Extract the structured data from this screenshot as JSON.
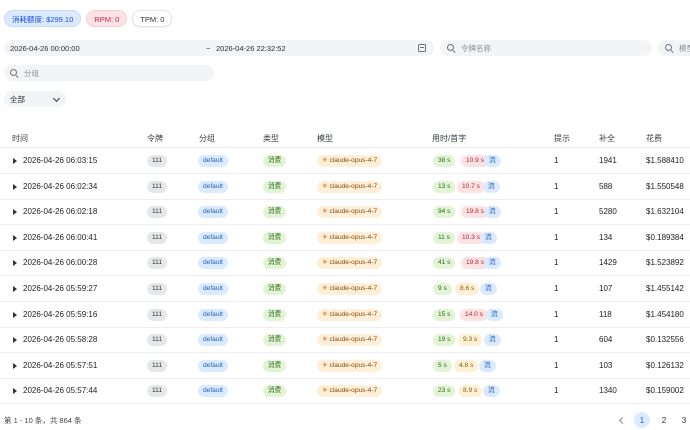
{
  "stats": {
    "quota": "消耗额度: $299.10",
    "rpm": "RPM: 0",
    "tpm": "TPM: 0"
  },
  "filters": {
    "start": "2026-04-26 00:00:00",
    "sep": "~",
    "end": "2026-04-26 22:32:52",
    "token_placeholder": "令牌名称",
    "model_placeholder": "模型",
    "group_placeholder": "分组",
    "type_select": "全部"
  },
  "columns": [
    "时间",
    "令牌",
    "分组",
    "类型",
    "模型",
    "用时/首字",
    "提示",
    "补全",
    "花费"
  ],
  "rows": [
    {
      "time": "2026-04-26 06:03:15",
      "token": "111",
      "group": "default",
      "type": "消费",
      "model": "claude-opus-4-7",
      "dur": "38 s",
      "ttft": "10.9 s",
      "stream": "流",
      "prompt": "1",
      "completion": "1941",
      "cost": "$1.588410"
    },
    {
      "time": "2026-04-26 06:02:34",
      "token": "111",
      "group": "default",
      "type": "消费",
      "model": "claude-opus-4-7",
      "dur": "13 s",
      "ttft": "10.7 s",
      "stream": "流",
      "prompt": "1",
      "completion": "588",
      "cost": "$1.550548"
    },
    {
      "time": "2026-04-26 06:02:18",
      "token": "111",
      "group": "default",
      "type": "消费",
      "model": "claude-opus-4-7",
      "dur": "94 s",
      "ttft": "19.8 s",
      "stream": "流",
      "prompt": "1",
      "completion": "5280",
      "cost": "$1.632104"
    },
    {
      "time": "2026-04-26 06:00:41",
      "token": "111",
      "group": "default",
      "type": "消费",
      "model": "claude-opus-4-7",
      "dur": "11 s",
      "ttft": "10.3 s",
      "stream": "流",
      "prompt": "1",
      "completion": "134",
      "cost": "$0.189384"
    },
    {
      "time": "2026-04-26 06:00:28",
      "token": "111",
      "group": "default",
      "type": "消费",
      "model": "claude-opus-4-7",
      "dur": "41 s",
      "ttft": "19.8 s",
      "stream": "流",
      "prompt": "1",
      "completion": "1429",
      "cost": "$1.523892"
    },
    {
      "time": "2026-04-26 05:59:27",
      "token": "111",
      "group": "default",
      "type": "消费",
      "model": "claude-opus-4-7",
      "dur": "9 s",
      "ttft": "8.6 s",
      "stream": "流",
      "prompt": "1",
      "completion": "107",
      "cost": "$1.455142"
    },
    {
      "time": "2026-04-26 05:59:16",
      "token": "111",
      "group": "default",
      "type": "消费",
      "model": "claude-opus-4-7",
      "dur": "15 s",
      "ttft": "14.0 s",
      "stream": "流",
      "prompt": "1",
      "completion": "118",
      "cost": "$1.454180"
    },
    {
      "time": "2026-04-26 05:58:28",
      "token": "111",
      "group": "default",
      "type": "消费",
      "model": "claude-opus-4-7",
      "dur": "19 s",
      "ttft": "9.3 s",
      "stream": "流",
      "prompt": "1",
      "completion": "604",
      "cost": "$0.132556"
    },
    {
      "time": "2026-04-26 05:57:51",
      "token": "111",
      "group": "default",
      "type": "消费",
      "model": "claude-opus-4-7",
      "dur": "5 s",
      "ttft": "4.8 s",
      "stream": "流",
      "prompt": "1",
      "completion": "103",
      "cost": "$0.126132"
    },
    {
      "time": "2026-04-26 05:57:44",
      "token": "111",
      "group": "default",
      "type": "消费",
      "model": "claude-opus-4-7",
      "dur": "23 s",
      "ttft": "8.9 s",
      "stream": "流",
      "prompt": "1",
      "completion": "1340",
      "cost": "$0.159002"
    }
  ],
  "footer": {
    "summary": "第 1 - 10 条，共 864 条",
    "pages": [
      "1",
      "2",
      "3"
    ]
  },
  "colors": {
    "accent": "#1d5fc2",
    "quota_bg": "#dbeafe",
    "rpm_bg": "#fde2e6"
  },
  "icons": {
    "search": "search-icon",
    "calendar": "calendar-icon",
    "expand": "triangle-right-icon",
    "dropdown": "chevron-down-icon",
    "prev": "chevron-left-icon",
    "model": "sparkle-icon"
  }
}
